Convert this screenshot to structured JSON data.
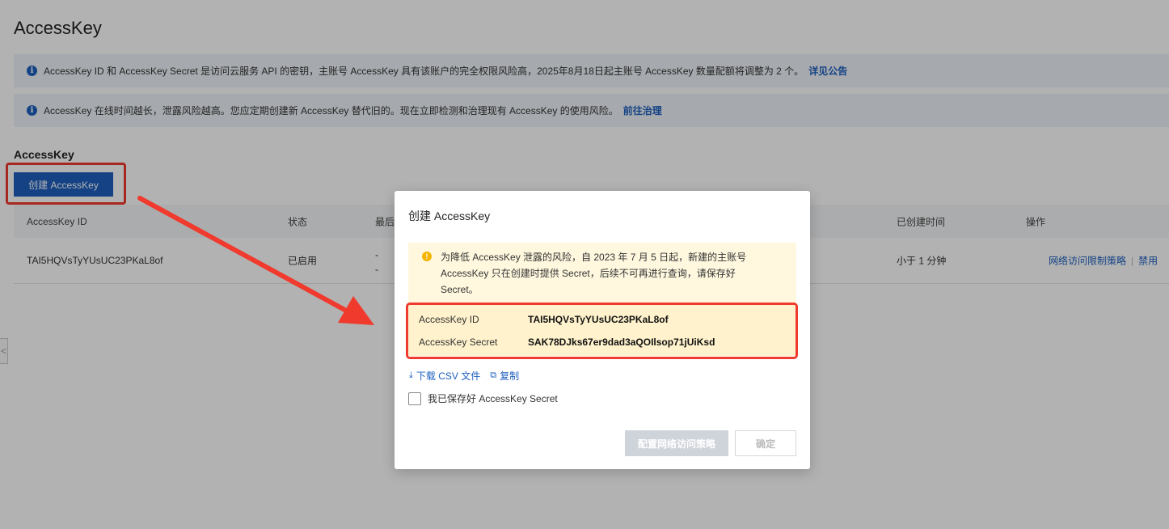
{
  "page": {
    "title": "AccessKey",
    "notice1": {
      "text": "AccessKey ID 和 AccessKey Secret 是访问云服务 API 的密钥，主账号 AccessKey 具有该账户的完全权限风险高，2025年8月18日起主账号 AccessKey 数量配额将调整为 2 个。",
      "link": "详见公告",
      "icon": "info-icon"
    },
    "notice2": {
      "text": "AccessKey 在线时间越长，泄露风险越高。您应定期创建新 AccessKey 替代旧的。现在立即检测和治理现有 AccessKey 的使用风险。",
      "link": "前往治理",
      "icon": "info-icon"
    },
    "section_title": "AccessKey",
    "create_button": "创建 AccessKey",
    "table": {
      "headers": {
        "id": "AccessKey ID",
        "status": "状态",
        "last_used": "最后",
        "created": "已创建时间",
        "actions": "操作"
      },
      "row": {
        "id": "TAI5HQVsTyYUsUC23PKaL8of",
        "status": "已启用",
        "last_used_1": "-",
        "last_used_2": "-",
        "created": "小于 1 分钟",
        "action_policy": "网络访问限制策略",
        "action_disable": "禁用"
      }
    },
    "side_tab": "<"
  },
  "dialog": {
    "title": "创建 AccessKey",
    "warning_text": "为降低 AccessKey 泄露的风险，自 2023 年 7 月 5 日起，新建的主账号 AccessKey 只在创建时提供 Secret，后续不可再进行查询，请保存好 Secret。",
    "warning_icon": "exclamation-icon",
    "key_id_label": "AccessKey ID",
    "key_id_value": "TAI5HQVsTyYUsUC23PKaL8of",
    "secret_label": "AccessKey Secret",
    "secret_value": "SAK78DJks67er9dad3aQOIlsop71jUiKsd",
    "download_label": "下载 CSV 文件",
    "copy_label": "复制",
    "checkbox_label": "我已保存好 AccessKey Secret",
    "policy_button": "配置网络访问策略",
    "ok_button": "确定"
  },
  "colors": {
    "primary": "#1d5fbf",
    "annotation_red": "#f03a2e",
    "warning_bg": "#fff8df"
  }
}
